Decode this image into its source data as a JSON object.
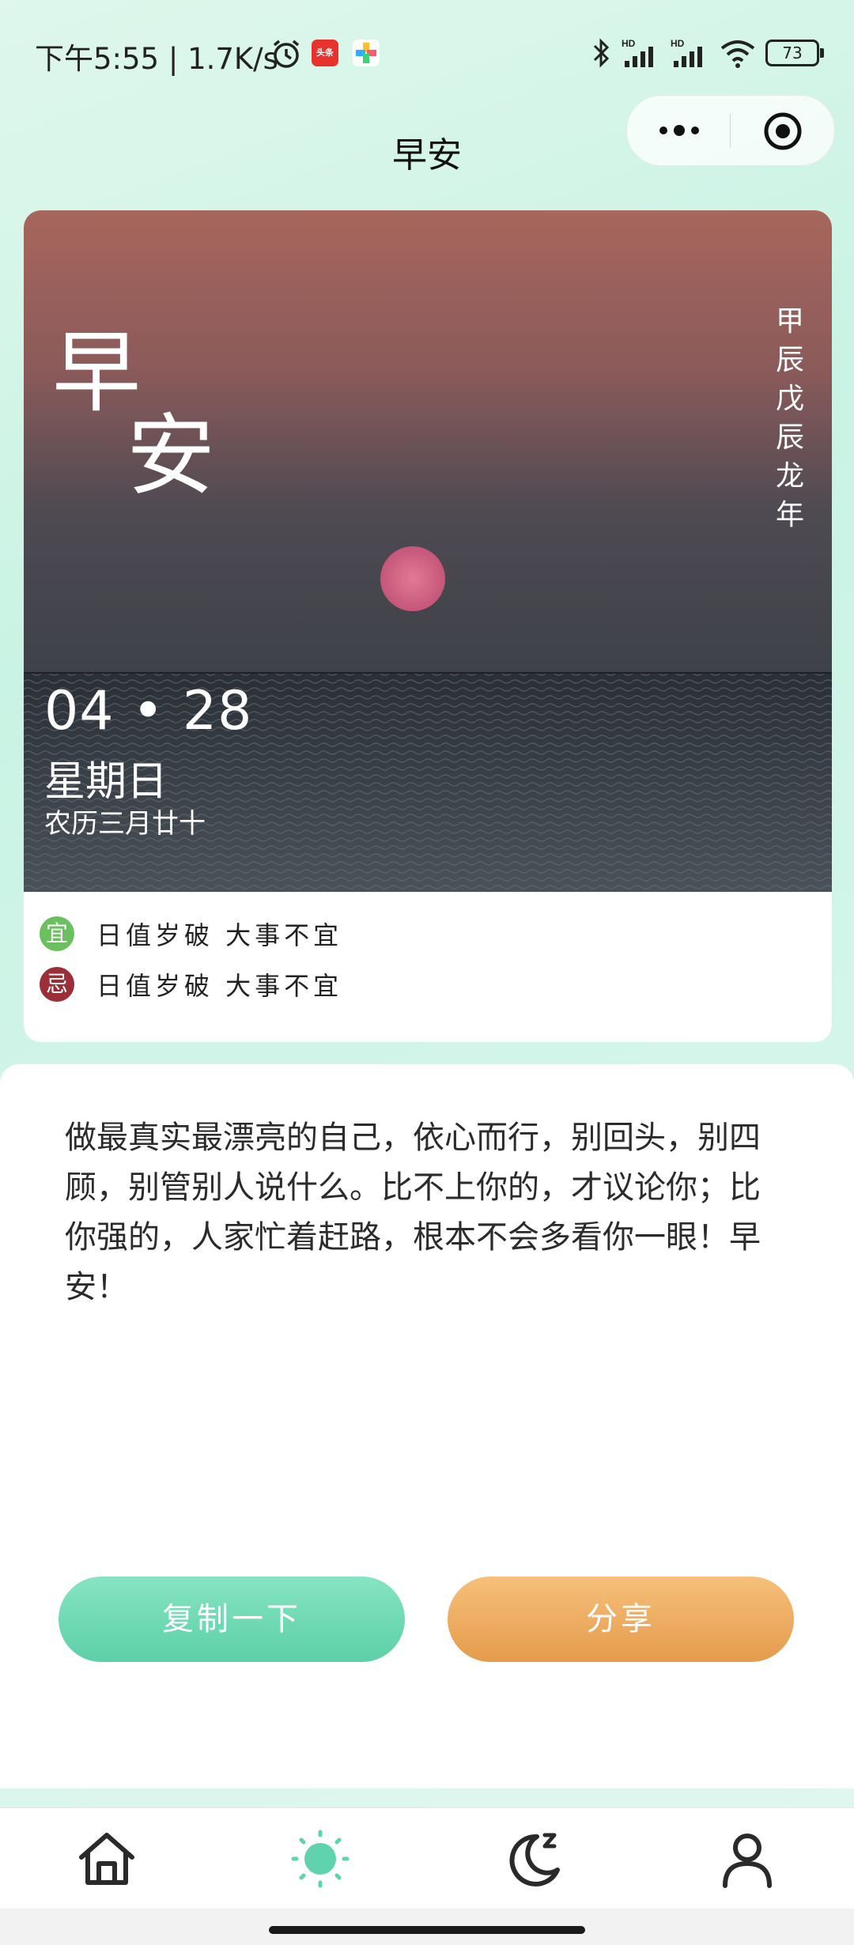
{
  "status_bar": {
    "time": "下午5:55 | 1.7K/s",
    "toutiao_icon_text": "头条",
    "battery": "73"
  },
  "nav": {
    "title": "早安"
  },
  "card": {
    "big_text_1": "早",
    "big_text_2": "安",
    "ganzhi": "甲辰戊辰龙年",
    "date": "04 • 28",
    "weekday": "星期日",
    "lunar": "农历三月廿十",
    "yi_label": "宜",
    "yi_text": "日值岁破 大事不宜",
    "ji_label": "忌",
    "ji_text": "日值岁破 大事不宜"
  },
  "content": {
    "quote": "做最真实最漂亮的自己，依心而行，别回头，别四顾，别管别人说什么。比不上你的，才议论你；比你强的，人家忙着赶路，根本不会多看你一眼！早安！",
    "copy_button": "复制一下",
    "share_button": "分享"
  },
  "tabbar": {
    "items": [
      "home-icon",
      "sun-icon",
      "moon-sleep-icon",
      "person-icon"
    ]
  },
  "colors": {
    "yi_badge": "#6abf5e",
    "ji_badge": "#9b2f38",
    "accent_green": "#5cd0a8",
    "accent_orange": "#e59b4c"
  }
}
